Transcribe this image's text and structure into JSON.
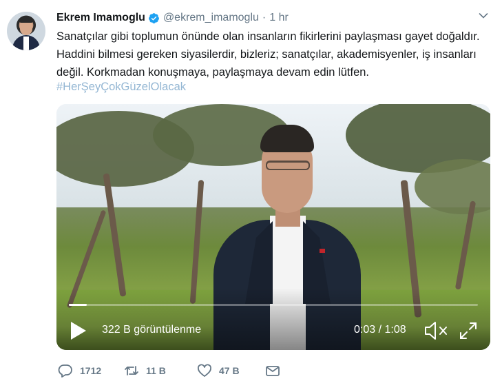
{
  "tweet": {
    "author_name": "Ekrem Imamoglu",
    "handle": "@ekrem_imamoglu",
    "separator": "·",
    "time": "1 hr",
    "text": "Sanatçılar gibi toplumun önünde olan insanların fikirlerini paylaşması gayet doğaldır. Haddini bilmesi gereken siyasilerdir, bizleriz;  sanatçılar, akademisyenler, iş insanları değil. Korkmadan konuşmaya, paylaşmaya devam edin lütfen.",
    "hashtag": "#HerŞeyÇokGüzelOlacak"
  },
  "video": {
    "views": "322 B görüntülenme",
    "time_display": "0:03 / 1:08",
    "progress_fraction": 0.044
  },
  "actions": {
    "reply_count": "1712",
    "retweet_count": "11 B",
    "like_count": "47 B"
  },
  "colors": {
    "verified": "#1da1f2",
    "muted": "#657786",
    "hashtag": "#93b6d3"
  }
}
